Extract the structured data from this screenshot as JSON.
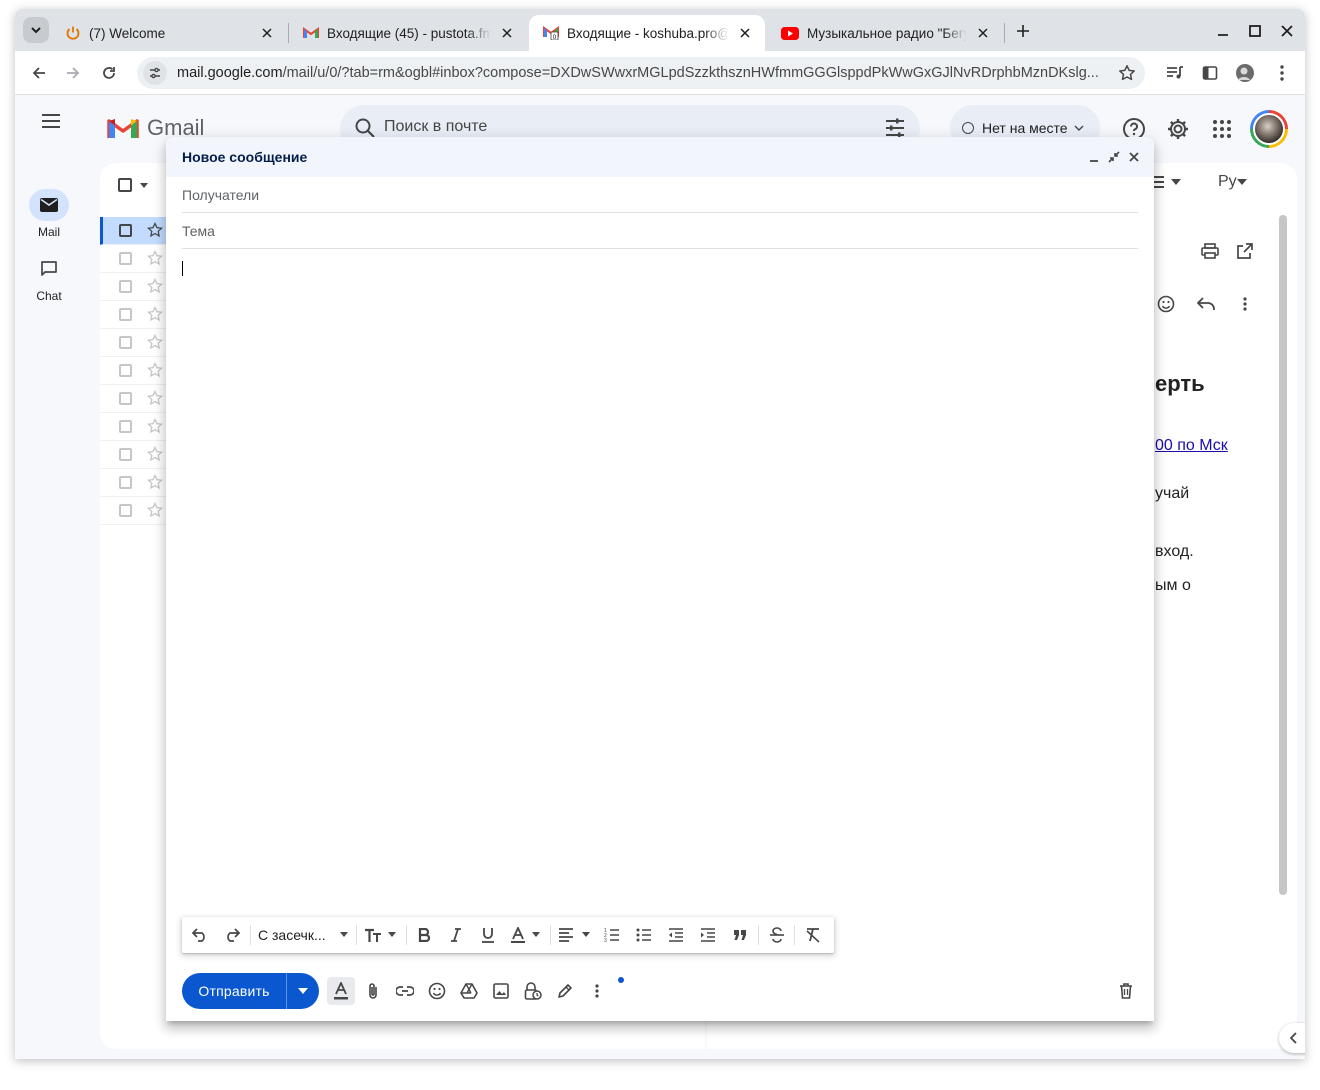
{
  "browser": {
    "tabs": [
      {
        "title": "(7) Welcome",
        "icon": "power-icon"
      },
      {
        "title": "Входящие (45) - pustota.fm",
        "icon": "gmail-icon"
      },
      {
        "title": "Входящие - koshuba.pro@",
        "icon": "gmail-icon",
        "active": true
      },
      {
        "title": "Музыкальное радио \"Бегу",
        "icon": "youtube-icon"
      }
    ],
    "url_host": "mail.google.com",
    "url_path": "/mail/u/0/?tab=rm&ogbl#inbox?compose=DXDwSWwxrMGLpdSzzkthsznHWfmmGGGlsppdPkWwGxGJlNvRDrphbMznDKslg..."
  },
  "gmail": {
    "logo_text": "Gmail",
    "search_placeholder": "Поиск в почте",
    "status": "Нет на месте",
    "rail": {
      "mail": "Mail",
      "chat": "Chat"
    },
    "lang_label": "Ру",
    "reading_fragments": {
      "heading": "ерть",
      "link": "00 по Мск",
      "line1": "учай",
      "line2": "вход.",
      "line3": "ым о"
    }
  },
  "compose": {
    "title": "Новое сообщение",
    "recipients_placeholder": "Получатели",
    "subject_placeholder": "Тема",
    "font_label": "С засечк...",
    "send_label": "Отправить"
  },
  "colors": {
    "accent": "#0b57d0",
    "compose_header": "#f2f6fc",
    "page_bg": "#f6f8fc"
  }
}
